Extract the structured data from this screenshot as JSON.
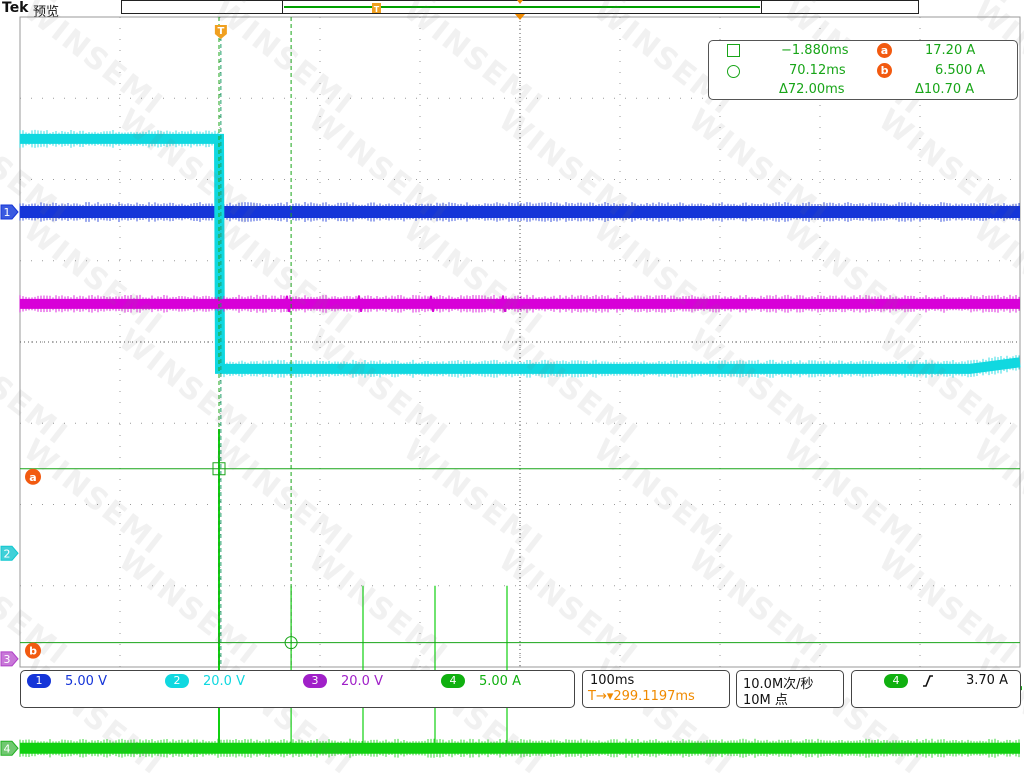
{
  "header": {
    "brand": "Tek",
    "mode": "预览"
  },
  "trigger_marker_label": "T",
  "readout": {
    "cursor_a_time": "−1.880ms",
    "cursor_a_symbol": "square",
    "cursor_b_time": "70.12ms",
    "cursor_b_symbol": "circle",
    "delta_time": "Δ72.00ms",
    "a_badge": "a",
    "b_badge": "b",
    "a_value": "17.20 A",
    "b_value": "6.500 A",
    "delta_value": "Δ10.70 A"
  },
  "left_markers": [
    "1",
    "2",
    "3",
    "4"
  ],
  "cursor_badges": [
    "a",
    "b"
  ],
  "channels": [
    {
      "num": "1",
      "scale": "5.00 V",
      "color": "#1535d8"
    },
    {
      "num": "2",
      "scale": "20.0 V",
      "color": "#10d8e0"
    },
    {
      "num": "3",
      "scale": "20.0 V",
      "color": "#a020c8"
    },
    {
      "num": "4",
      "scale": "5.00 A",
      "color": "#10c010"
    }
  ],
  "timebase": {
    "scale": "100ms",
    "trigger_position": "T→▾299.1197ms"
  },
  "acquisition": {
    "sample_rate": "10.0M次/秒",
    "record_length": "10M 点"
  },
  "trigger": {
    "source": "4",
    "slope_symbol": "rising-edge",
    "level": "3.70 A"
  },
  "watermark_text": "WINSEMI",
  "chart_data": {
    "type": "line",
    "x_unit": "ms",
    "xlim": [
      -500,
      500
    ],
    "x_per_div": 100,
    "trigger_time_ms": -299.12,
    "cursors": {
      "a": {
        "time_ms": -301.0,
        "value_A": 17.2
      },
      "b": {
        "time_ms": -228.9,
        "value_A": 6.5
      },
      "delta_time_ms": 72.0,
      "delta_value_A": 10.7
    },
    "series": [
      {
        "channel": 1,
        "color": "#1535d8",
        "volts_per_div": 5.0,
        "offset_div": 1.6,
        "x": [
          -500,
          500
        ],
        "y_div": [
          1.6,
          1.6
        ]
      },
      {
        "channel": 2,
        "color": "#10d8e0",
        "volts_per_div": 20.0,
        "offset_div": -2.6,
        "x": [
          -500,
          -301,
          -300,
          450,
          500
        ],
        "y_div": [
          2.5,
          2.5,
          -0.33,
          -0.33,
          -0.25
        ]
      },
      {
        "channel": 3,
        "color": "#d800d8",
        "volts_per_div": 20.0,
        "offset_div": -3.9,
        "x": [
          -500,
          500
        ],
        "y_div": [
          0.47,
          0.47
        ]
      },
      {
        "channel": 4,
        "color": "#10d010",
        "amps_per_div": 5.0,
        "offset_div": -5.0,
        "x": [
          -500,
          500
        ],
        "y_div": [
          -5.0,
          -5.0
        ],
        "spikes": [
          {
            "time_ms": -301.0,
            "peak_div": -1.07
          },
          {
            "time_ms": -228.9,
            "peak_div": -3.0
          },
          {
            "time_ms": -157.0,
            "peak_div": -3.0
          },
          {
            "time_ms": -85.0,
            "peak_div": -3.0
          },
          {
            "time_ms": -13.0,
            "peak_div": -3.0
          }
        ]
      }
    ]
  }
}
